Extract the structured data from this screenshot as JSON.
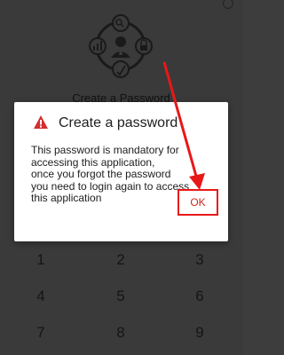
{
  "background": {
    "title": "Create a Password",
    "icons": [
      "info-icon",
      "security-logo-icon"
    ]
  },
  "keypad": {
    "keys": [
      "1",
      "2",
      "3",
      "4",
      "5",
      "6",
      "7",
      "8",
      "9"
    ]
  },
  "dialog": {
    "icon": "warning-icon",
    "title": "Create a password",
    "lines": [
      "This password is mandatory for",
      "accessing this application,",
      "once you forgot the password",
      "you need to login again to access",
      "this application"
    ],
    "ok_label": "OK"
  },
  "colors": {
    "overlay": "#3a3a3a",
    "dialog_bg": "#ffffff",
    "ok_text": "#cc2a1f",
    "highlight": "#e81818",
    "warning": "#d32f2f"
  }
}
